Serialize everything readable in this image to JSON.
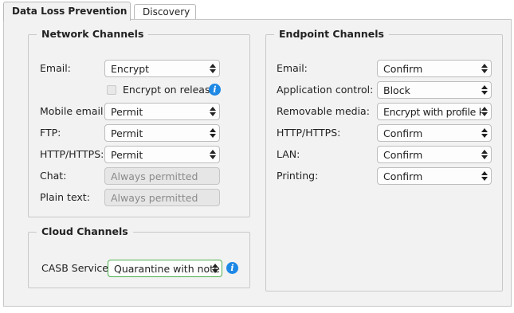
{
  "tabs": [
    {
      "label": "Data Loss Prevention"
    },
    {
      "label": "Discovery"
    }
  ],
  "network": {
    "title": "Network Channels",
    "email": {
      "label": "Email:",
      "value": "Encrypt"
    },
    "encrypt_on_release": {
      "label": "Encrypt on release",
      "checked": false
    },
    "mobile_email": {
      "label": "Mobile email:",
      "value": "Permit"
    },
    "ftp": {
      "label": "FTP:",
      "value": "Permit"
    },
    "http": {
      "label": "HTTP/HTTPS:",
      "value": "Permit"
    },
    "chat": {
      "label": "Chat:",
      "value": "Always permitted"
    },
    "plain_text": {
      "label": "Plain text:",
      "value": "Always permitted"
    }
  },
  "cloud": {
    "title": "Cloud Channels",
    "casb": {
      "label": "CASB Service:",
      "value": "Quarantine with note"
    }
  },
  "endpoint": {
    "title": "Endpoint Channels",
    "email": {
      "label": "Email:",
      "value": "Confirm"
    },
    "app_control": {
      "label": "Application control:",
      "value": "Block"
    },
    "removable": {
      "label": "Removable media:",
      "value": "Encrypt with profile k"
    },
    "http": {
      "label": "HTTP/HTTPS:",
      "value": "Confirm"
    },
    "lan": {
      "label": "LAN:",
      "value": "Confirm"
    },
    "printing": {
      "label": "Printing:",
      "value": "Confirm"
    }
  },
  "colors": {
    "info": "#1e88e5",
    "casb_border": "#4caf50",
    "panel_bg": "#f2f2f2"
  },
  "icons": {
    "info": "info-icon",
    "select_arrow": "chevron-updown-icon"
  }
}
